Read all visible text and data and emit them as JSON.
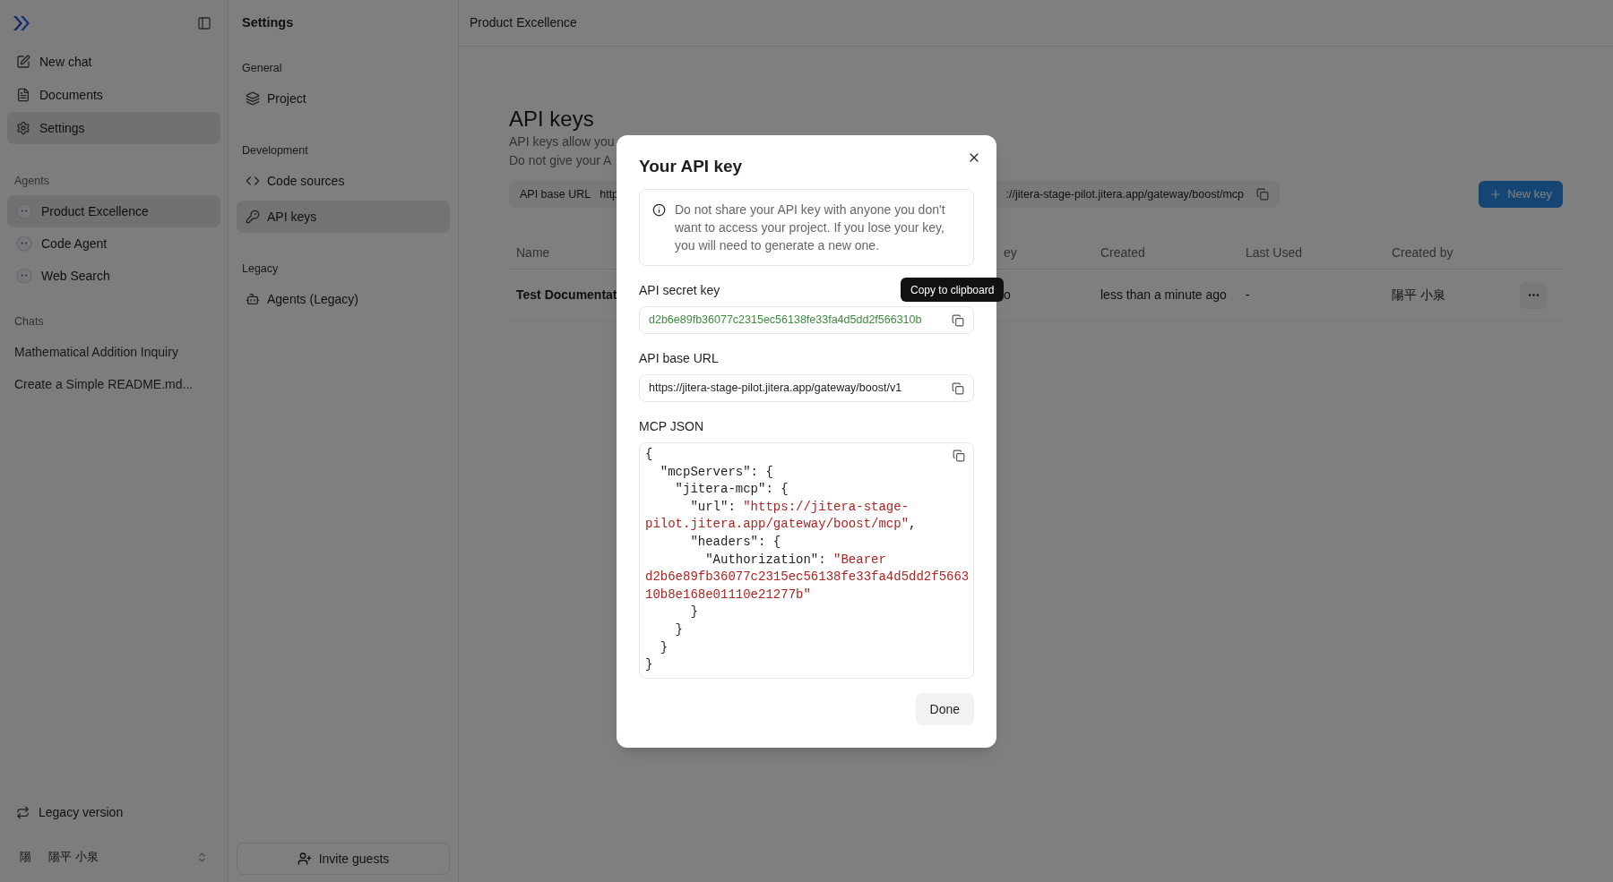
{
  "sidebar": {
    "nav": [
      {
        "label": "New chat",
        "selected": false
      },
      {
        "label": "Documents",
        "selected": false
      },
      {
        "label": "Settings",
        "selected": true
      }
    ],
    "agents_heading": "Agents",
    "agents": [
      {
        "label": "Product Excellence",
        "selected": true
      },
      {
        "label": "Code Agent",
        "selected": false
      },
      {
        "label": "Web Search",
        "selected": false
      }
    ],
    "chats_heading": "Chats",
    "chats": [
      {
        "label": "Mathematical Addition Inquiry",
        "selected": false
      },
      {
        "label": "Create a Simple README.md...",
        "selected": false
      }
    ],
    "legacy_link": "Legacy version",
    "user": {
      "initial": "陽",
      "name": "陽平 小泉"
    }
  },
  "settings": {
    "title": "Settings",
    "sections": [
      {
        "heading": "General",
        "items": [
          {
            "label": "Project",
            "selected": false
          }
        ]
      },
      {
        "heading": "Development",
        "items": [
          {
            "label": "Code sources",
            "selected": false
          },
          {
            "label": "API keys",
            "selected": true
          }
        ]
      },
      {
        "heading": "Legacy",
        "items": [
          {
            "label": "Agents (Legacy)",
            "selected": false
          }
        ]
      }
    ],
    "invite_button": "Invite guests"
  },
  "main": {
    "breadcrumb": "Product Excellence",
    "title": "API keys",
    "description": [
      "API keys allow you",
      "Do not give your A"
    ],
    "base_url_bar": {
      "label": "API base URL",
      "value_start": "http",
      "value_end": "://jitera-stage-pilot.jitera.app/gateway/boost/mcp"
    },
    "new_key_button": "New key",
    "table": {
      "columns": [
        "Name",
        "ey",
        "Created",
        "Last Used",
        "Created by"
      ],
      "rows": [
        {
          "cells": [
            "Test Documentat",
            "o",
            "less than a minute ago",
            "-",
            "陽平 小泉"
          ]
        }
      ]
    }
  },
  "modal": {
    "title": "Your API key",
    "notice": "Do not share your API key with anyone you don't want to access your project. If you lose your key, you will need to generate a new one.",
    "fields": [
      {
        "label": "API secret key",
        "value": "d2b6e89fb36077c2315ec56138fe33fa4d5dd2f566310b",
        "kind": "secret"
      },
      {
        "label": "API base URL",
        "value": "https://jitera-stage-pilot.jitera.app/gateway/boost/v1",
        "kind": "url"
      }
    ],
    "mcp_label": "MCP JSON",
    "mcp_lines": [
      [
        {
          "text": "{",
          "kind": "plain"
        }
      ],
      [
        {
          "text": "  \"mcpServers\": {",
          "kind": "plain"
        }
      ],
      [
        {
          "text": "    \"jitera-mcp\": {",
          "kind": "plain"
        }
      ],
      [
        {
          "text": "      \"url\": ",
          "kind": "plain"
        },
        {
          "text": "\"https://jitera-stage-",
          "kind": "string"
        }
      ],
      [
        {
          "text": "pilot.jitera.app/gateway/boost/mcp\"",
          "kind": "string"
        },
        {
          "text": ",",
          "kind": "plain"
        }
      ],
      [
        {
          "text": "      \"headers\": {",
          "kind": "plain"
        }
      ],
      [
        {
          "text": "        \"Authorization\": ",
          "kind": "plain"
        },
        {
          "text": "\"Bearer",
          "kind": "string"
        }
      ],
      [
        {
          "text": "d2b6e89fb36077c2315ec56138fe33fa4d5dd2f5663",
          "kind": "string"
        }
      ],
      [
        {
          "text": "10b8e168e01110e21277b\"",
          "kind": "string"
        }
      ],
      [
        {
          "text": "      }",
          "kind": "plain"
        }
      ],
      [
        {
          "text": "    }",
          "kind": "plain"
        }
      ],
      [
        {
          "text": "  }",
          "kind": "plain"
        }
      ],
      [
        {
          "text": "}",
          "kind": "plain"
        }
      ]
    ],
    "tooltip": "Copy to clipboard",
    "done_button": "Done"
  }
}
